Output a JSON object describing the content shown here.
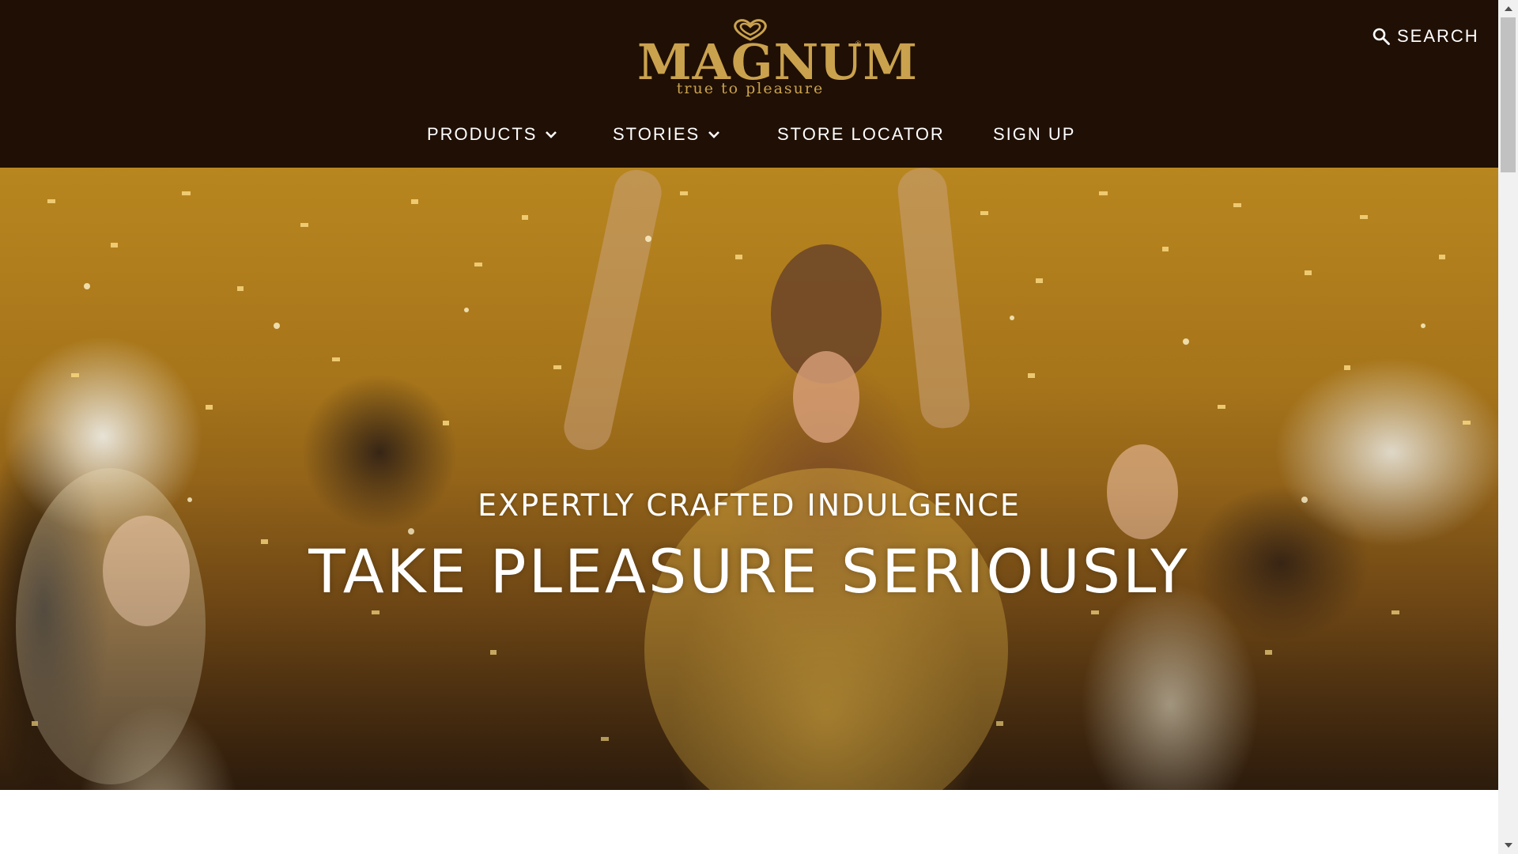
{
  "header": {
    "logo": {
      "wordmark": "MAGNUM",
      "tagline": "true to pleasure",
      "registered": "®"
    },
    "search_label": "SEARCH",
    "nav": [
      {
        "label": "PRODUCTS",
        "has_dropdown": true
      },
      {
        "label": "STORIES",
        "has_dropdown": true
      },
      {
        "label": "STORE LOCATOR",
        "has_dropdown": false
      },
      {
        "label": "SIGN UP",
        "has_dropdown": false
      }
    ]
  },
  "hero": {
    "subtitle": "EXPERTLY CRAFTED INDULGENCE",
    "title": "TAKE PLEASURE SERIOUSLY"
  },
  "icons": {
    "search": "search-icon",
    "dropdown": "chevron-down-icon",
    "logo_mark": "heart-icon",
    "scroll_up": "arrow-up-icon",
    "scroll_down": "arrow-down-icon"
  },
  "colors": {
    "header_bg": "#1f0f04",
    "brand_gold": "#caa24e",
    "nav_text": "#ffffff",
    "hero_text": "#ffffff",
    "scrollbar_track": "#f1f1f1",
    "scrollbar_thumb": "#c1c1c1"
  }
}
